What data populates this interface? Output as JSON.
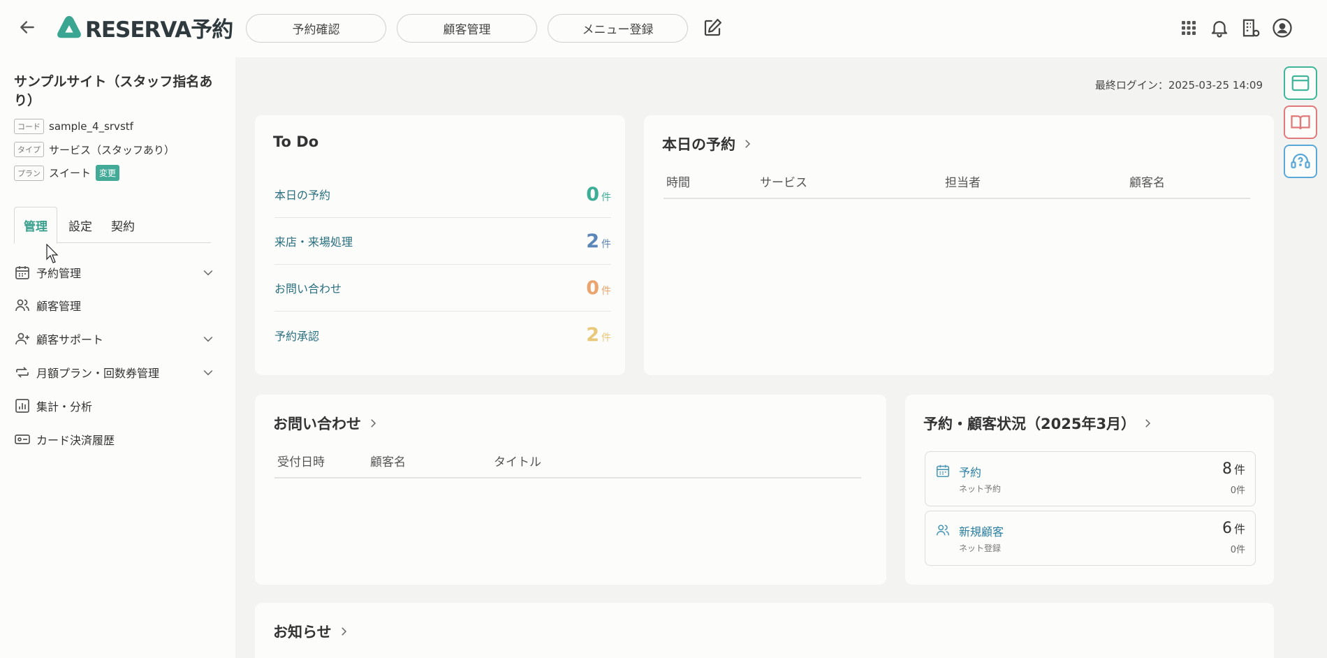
{
  "header": {
    "logo_text": "RESERVA予約",
    "nav": [
      "予約確認",
      "顧客管理",
      "メニュー登録"
    ]
  },
  "sidebar": {
    "site_name": "サンプルサイト（スタッフ指名あり）",
    "code_tag": "コード",
    "code_value": "sample_4_srvstf",
    "type_tag": "タイプ",
    "type_value": "サービス（スタッフあり）",
    "plan_tag": "プラン",
    "plan_value": "スイート",
    "plan_change": "変更",
    "tabs": [
      "管理",
      "設定",
      "契約"
    ],
    "menu": [
      {
        "label": "予約管理",
        "icon": "calendar-icon",
        "expandable": true
      },
      {
        "label": "顧客管理",
        "icon": "users-icon",
        "expandable": false
      },
      {
        "label": "顧客サポート",
        "icon": "user-plus-icon",
        "expandable": true
      },
      {
        "label": "月額プラン・回数券管理",
        "icon": "repeat-icon",
        "expandable": true
      },
      {
        "label": "集計・分析",
        "icon": "bar-chart-icon",
        "expandable": false
      },
      {
        "label": "カード決済履歴",
        "icon": "card-icon",
        "expandable": false
      }
    ]
  },
  "main": {
    "last_login": "最終ログイン：2025-03-25 14:09",
    "todo": {
      "title": "To Do",
      "items": [
        {
          "label": "本日の予約",
          "count": "0",
          "unit": "件",
          "color": "#3cae96"
        },
        {
          "label": "来店・来場処理",
          "count": "2",
          "unit": "件",
          "color": "#5b86b8"
        },
        {
          "label": "お問い合わせ",
          "count": "0",
          "unit": "件",
          "color": "#eba46e"
        },
        {
          "label": "予約承認",
          "count": "2",
          "unit": "件",
          "color": "#e9c87a"
        }
      ]
    },
    "today": {
      "title": "本日の予約",
      "columns": [
        "時間",
        "サービス",
        "担当者",
        "顧客名"
      ]
    },
    "inquiry": {
      "title": "お問い合わせ",
      "columns": [
        "受付日時",
        "顧客名",
        "タイトル"
      ]
    },
    "status": {
      "title": "予約・顧客状況（2025年3月）",
      "boxes": [
        {
          "label": "予約",
          "sub": "ネット予約",
          "count": "8",
          "unit": "件",
          "subcount": "0件",
          "icon": "calendar-icon"
        },
        {
          "label": "新規顧客",
          "sub": "ネット登録",
          "count": "6",
          "unit": "件",
          "subcount": "0件",
          "icon": "users-icon"
        }
      ]
    },
    "news": {
      "title": "お知らせ"
    }
  },
  "colors": {
    "accent": "#3aa08e",
    "link": "#2a6f80"
  }
}
